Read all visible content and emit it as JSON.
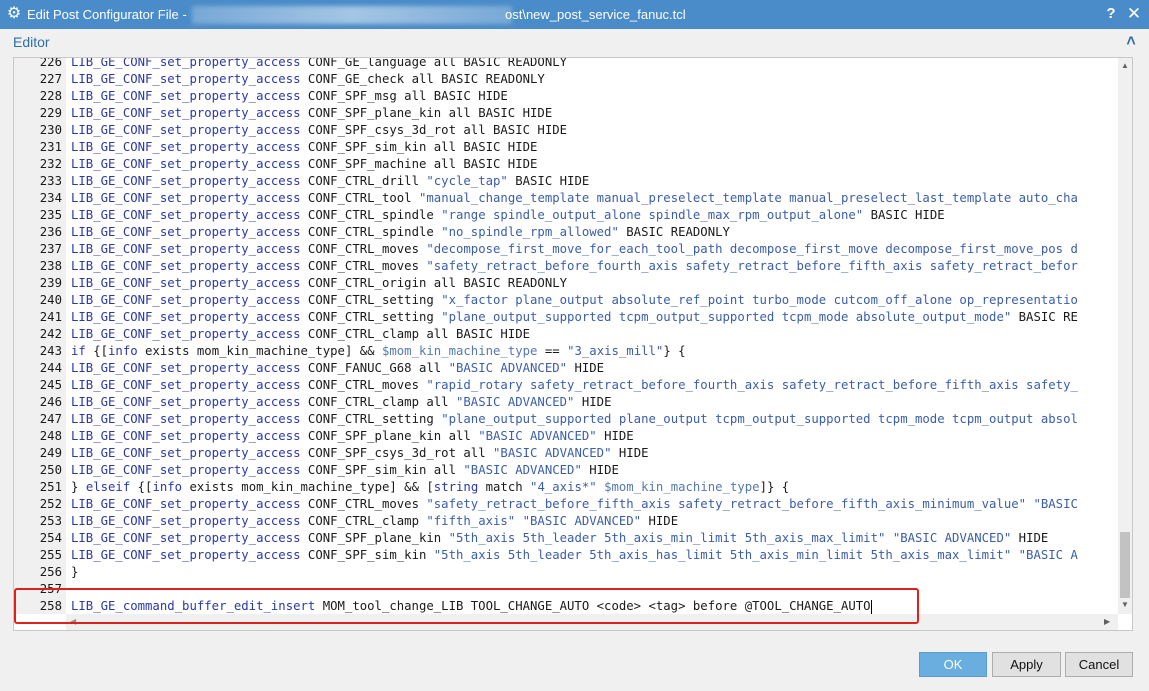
{
  "window": {
    "title_prefix": "Edit Post Configurator File - ",
    "title_path": "ost\\new_post_service_fanuc.tcl",
    "help_icon": "question-icon",
    "close_icon": "close-icon"
  },
  "editor": {
    "label": "Editor",
    "collapse_icon": "chevron-up-icon",
    "lines": [
      {
        "n": "226",
        "segs": [
          [
            "k",
            "LIB_GE_CONF_set_property_access"
          ],
          [
            "t",
            " CONF_GE_language all BASIC READONLY"
          ]
        ]
      },
      {
        "n": "227",
        "segs": [
          [
            "k",
            "LIB_GE_CONF_set_property_access"
          ],
          [
            "t",
            " CONF_GE_check all BASIC READONLY"
          ]
        ]
      },
      {
        "n": "228",
        "segs": [
          [
            "k",
            "LIB_GE_CONF_set_property_access"
          ],
          [
            "t",
            " CONF_SPF_msg all BASIC HIDE"
          ]
        ]
      },
      {
        "n": "229",
        "segs": [
          [
            "k",
            "LIB_GE_CONF_set_property_access"
          ],
          [
            "t",
            " CONF_SPF_plane_kin all BASIC HIDE"
          ]
        ]
      },
      {
        "n": "230",
        "segs": [
          [
            "k",
            "LIB_GE_CONF_set_property_access"
          ],
          [
            "t",
            " CONF_SPF_csys_3d_rot all BASIC HIDE"
          ]
        ]
      },
      {
        "n": "231",
        "segs": [
          [
            "k",
            "LIB_GE_CONF_set_property_access"
          ],
          [
            "t",
            " CONF_SPF_sim_kin all BASIC HIDE"
          ]
        ]
      },
      {
        "n": "232",
        "segs": [
          [
            "k",
            "LIB_GE_CONF_set_property_access"
          ],
          [
            "t",
            " CONF_SPF_machine all BASIC HIDE"
          ]
        ]
      },
      {
        "n": "233",
        "segs": [
          [
            "k",
            "LIB_GE_CONF_set_property_access"
          ],
          [
            "t",
            " CONF_CTRL_drill "
          ],
          [
            "s",
            "\"cycle_tap\""
          ],
          [
            "t",
            " BASIC HIDE"
          ]
        ]
      },
      {
        "n": "234",
        "segs": [
          [
            "k",
            "LIB_GE_CONF_set_property_access"
          ],
          [
            "t",
            " CONF_CTRL_tool "
          ],
          [
            "s",
            "\"manual_change_template manual_preselect_template manual_preselect_last_template auto_cha"
          ]
        ]
      },
      {
        "n": "235",
        "segs": [
          [
            "k",
            "LIB_GE_CONF_set_property_access"
          ],
          [
            "t",
            " CONF_CTRL_spindle "
          ],
          [
            "s",
            "\"range spindle_output_alone spindle_max_rpm_output_alone\""
          ],
          [
            "t",
            " BASIC HIDE"
          ]
        ]
      },
      {
        "n": "236",
        "segs": [
          [
            "k",
            "LIB_GE_CONF_set_property_access"
          ],
          [
            "t",
            " CONF_CTRL_spindle "
          ],
          [
            "s",
            "\"no_spindle_rpm_allowed\""
          ],
          [
            "t",
            " BASIC READONLY"
          ]
        ]
      },
      {
        "n": "237",
        "segs": [
          [
            "k",
            "LIB_GE_CONF_set_property_access"
          ],
          [
            "t",
            " CONF_CTRL_moves "
          ],
          [
            "s",
            "\"decompose_first_move_for_each_tool_path decompose_first_move decompose_first_move_pos d"
          ]
        ]
      },
      {
        "n": "238",
        "segs": [
          [
            "k",
            "LIB_GE_CONF_set_property_access"
          ],
          [
            "t",
            " CONF_CTRL_moves "
          ],
          [
            "s",
            "\"safety_retract_before_fourth_axis safety_retract_before_fifth_axis safety_retract_befor"
          ]
        ]
      },
      {
        "n": "239",
        "segs": [
          [
            "k",
            "LIB_GE_CONF_set_property_access"
          ],
          [
            "t",
            " CONF_CTRL_origin all BASIC READONLY"
          ]
        ]
      },
      {
        "n": "240",
        "segs": [
          [
            "k",
            "LIB_GE_CONF_set_property_access"
          ],
          [
            "t",
            " CONF_CTRL_setting "
          ],
          [
            "s",
            "\"x_factor plane_output absolute_ref_point turbo_mode cutcom_off_alone op_representatio"
          ]
        ]
      },
      {
        "n": "241",
        "segs": [
          [
            "k",
            "LIB_GE_CONF_set_property_access"
          ],
          [
            "t",
            " CONF_CTRL_setting "
          ],
          [
            "s",
            "\"plane_output_supported tcpm_output_supported tcpm_mode absolute_output_mode\""
          ],
          [
            "t",
            " BASIC RE"
          ]
        ]
      },
      {
        "n": "242",
        "segs": [
          [
            "k",
            "LIB_GE_CONF_set_property_access"
          ],
          [
            "t",
            " CONF_CTRL_clamp all BASIC HIDE"
          ]
        ]
      },
      {
        "n": "243",
        "segs": [
          [
            "k",
            "if"
          ],
          [
            "t",
            " {["
          ],
          [
            "k",
            "info"
          ],
          [
            "t",
            " exists mom_kin_machine_type] && "
          ],
          [
            "v",
            "$mom_kin_machine_type"
          ],
          [
            "t",
            " == "
          ],
          [
            "s",
            "\"3_axis_mill\""
          ],
          [
            "t",
            "} {"
          ]
        ]
      },
      {
        "n": "244",
        "segs": [
          [
            "k",
            "LIB_GE_CONF_set_property_access"
          ],
          [
            "t",
            " CONF_FANUC_G68 all "
          ],
          [
            "s",
            "\"BASIC ADVANCED\""
          ],
          [
            "t",
            " HIDE"
          ]
        ]
      },
      {
        "n": "245",
        "segs": [
          [
            "k",
            "LIB_GE_CONF_set_property_access"
          ],
          [
            "t",
            " CONF_CTRL_moves "
          ],
          [
            "s",
            "\"rapid_rotary safety_retract_before_fourth_axis safety_retract_before_fifth_axis safety_"
          ]
        ]
      },
      {
        "n": "246",
        "segs": [
          [
            "k",
            "LIB_GE_CONF_set_property_access"
          ],
          [
            "t",
            " CONF_CTRL_clamp all "
          ],
          [
            "s",
            "\"BASIC ADVANCED\""
          ],
          [
            "t",
            " HIDE"
          ]
        ]
      },
      {
        "n": "247",
        "segs": [
          [
            "k",
            "LIB_GE_CONF_set_property_access"
          ],
          [
            "t",
            " CONF_CTRL_setting "
          ],
          [
            "s",
            "\"plane_output_supported plane_output tcpm_output_supported tcpm_mode tcpm_output absol"
          ]
        ]
      },
      {
        "n": "248",
        "segs": [
          [
            "k",
            "LIB_GE_CONF_set_property_access"
          ],
          [
            "t",
            " CONF_SPF_plane_kin all "
          ],
          [
            "s",
            "\"BASIC ADVANCED\""
          ],
          [
            "t",
            " HIDE"
          ]
        ]
      },
      {
        "n": "249",
        "segs": [
          [
            "k",
            "LIB_GE_CONF_set_property_access"
          ],
          [
            "t",
            " CONF_SPF_csys_3d_rot all "
          ],
          [
            "s",
            "\"BASIC ADVANCED\""
          ],
          [
            "t",
            " HIDE"
          ]
        ]
      },
      {
        "n": "250",
        "segs": [
          [
            "k",
            "LIB_GE_CONF_set_property_access"
          ],
          [
            "t",
            " CONF_SPF_sim_kin all "
          ],
          [
            "s",
            "\"BASIC ADVANCED\""
          ],
          [
            "t",
            " HIDE"
          ]
        ]
      },
      {
        "n": "251",
        "segs": [
          [
            "t",
            "} "
          ],
          [
            "k",
            "elseif"
          ],
          [
            "t",
            " {["
          ],
          [
            "k",
            "info"
          ],
          [
            "t",
            " exists mom_kin_machine_type] && ["
          ],
          [
            "k",
            "string"
          ],
          [
            "t",
            " match "
          ],
          [
            "s",
            "\"4_axis*\""
          ],
          [
            "t",
            " "
          ],
          [
            "v",
            "$mom_kin_machine_type"
          ],
          [
            "t",
            "]} {"
          ]
        ]
      },
      {
        "n": "252",
        "segs": [
          [
            "k",
            "LIB_GE_CONF_set_property_access"
          ],
          [
            "t",
            " CONF_CTRL_moves "
          ],
          [
            "s",
            "\"safety_retract_before_fifth_axis safety_retract_before_fifth_axis_minimum_value\""
          ],
          [
            "t",
            " "
          ],
          [
            "s",
            "\"BASIC"
          ]
        ]
      },
      {
        "n": "253",
        "segs": [
          [
            "k",
            "LIB_GE_CONF_set_property_access"
          ],
          [
            "t",
            " CONF_CTRL_clamp "
          ],
          [
            "s",
            "\"fifth_axis\""
          ],
          [
            "t",
            " "
          ],
          [
            "s",
            "\"BASIC ADVANCED\""
          ],
          [
            "t",
            " HIDE"
          ]
        ]
      },
      {
        "n": "254",
        "segs": [
          [
            "k",
            "LIB_GE_CONF_set_property_access"
          ],
          [
            "t",
            " CONF_SPF_plane_kin "
          ],
          [
            "s",
            "\"5th_axis 5th_leader 5th_axis_min_limit 5th_axis_max_limit\""
          ],
          [
            "t",
            " "
          ],
          [
            "s",
            "\"BASIC ADVANCED\""
          ],
          [
            "t",
            " HIDE"
          ]
        ]
      },
      {
        "n": "255",
        "segs": [
          [
            "k",
            "LIB_GE_CONF_set_property_access"
          ],
          [
            "t",
            " CONF_SPF_sim_kin "
          ],
          [
            "s",
            "\"5th_axis 5th_leader 5th_axis_has_limit 5th_axis_min_limit 5th_axis_max_limit\""
          ],
          [
            "t",
            " "
          ],
          [
            "s",
            "\"BASIC A"
          ]
        ]
      },
      {
        "n": "256",
        "segs": [
          [
            "t",
            "}"
          ]
        ]
      },
      {
        "n": "257",
        "segs": []
      },
      {
        "n": "258",
        "segs": [
          [
            "k",
            "LIB_GE_command_buffer_edit_insert"
          ],
          [
            "t",
            " MOM_tool_change_LIB TOOL_CHANGE_AUTO <code> <tag> before @TOOL_CHANGE_AUTO"
          ]
        ]
      }
    ]
  },
  "buttons": {
    "ok": "OK",
    "apply": "Apply",
    "cancel": "Cancel"
  },
  "colors": {
    "titlebar": "#4a8cc9",
    "keyword": "#2a38a8",
    "string": "#3b5ea8",
    "highlight_box": "#e0201a",
    "ok_button": "#6aaee0"
  }
}
